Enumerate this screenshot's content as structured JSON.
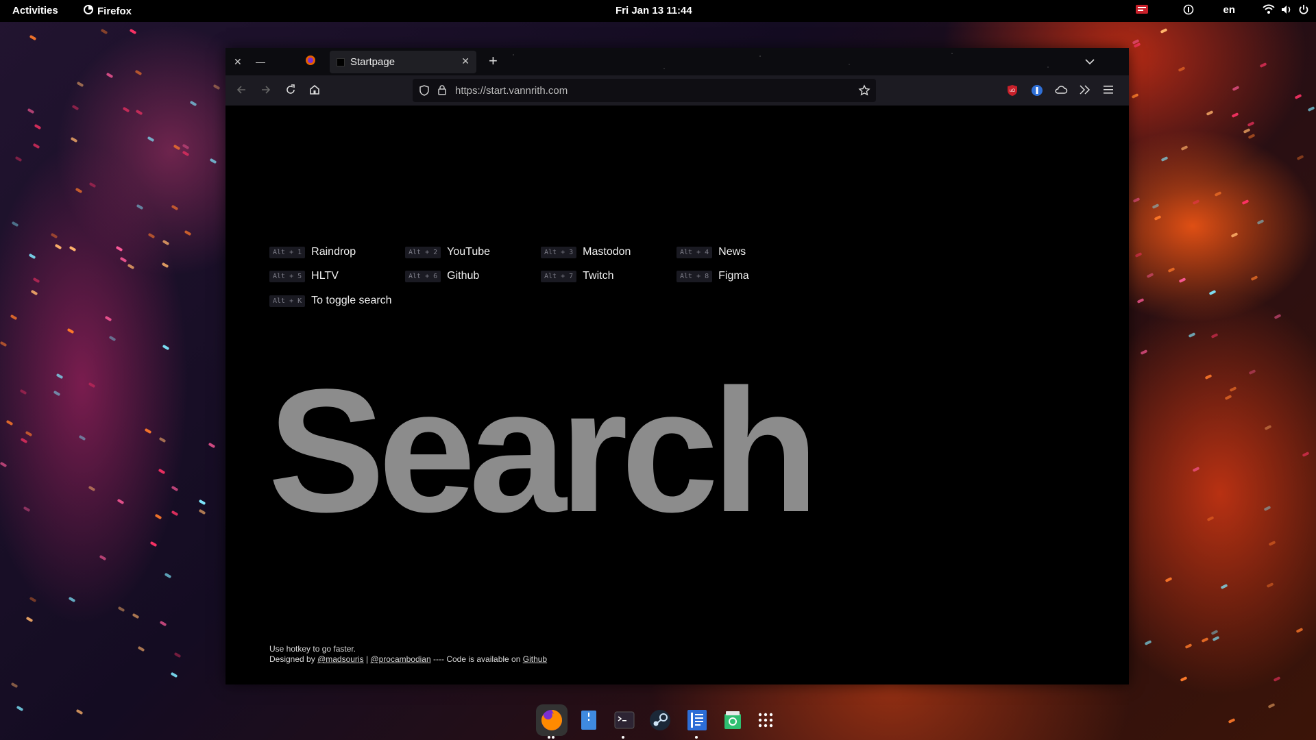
{
  "topbar": {
    "activities": "Activities",
    "app_name": "Firefox",
    "clock": "Fri Jan 13  11:44",
    "language": "en"
  },
  "browser": {
    "tab_title": "Startpage",
    "url": "https://start.vannrith.com"
  },
  "startpage": {
    "links": [
      {
        "hotkey": "Alt + 1",
        "name": "Raindrop"
      },
      {
        "hotkey": "Alt + 2",
        "name": "YouTube"
      },
      {
        "hotkey": "Alt + 3",
        "name": "Mastodon"
      },
      {
        "hotkey": "Alt + 4",
        "name": "News"
      },
      {
        "hotkey": "Alt + 5",
        "name": "HLTV"
      },
      {
        "hotkey": "Alt + 6",
        "name": "Github"
      },
      {
        "hotkey": "Alt + 7",
        "name": "Twitch"
      },
      {
        "hotkey": "Alt + 8",
        "name": "Figma"
      }
    ],
    "toggle_hotkey": "Alt + K",
    "toggle_label": "To toggle search",
    "search_title": "Search",
    "footer": {
      "line1": "Use hotkey to go faster.",
      "designed_by": "Designed by",
      "author1": "@madsouris",
      "separator": "|",
      "author2": "@procambodian",
      "code_text": "---- Code is available on",
      "code_link": "Github"
    }
  },
  "icons": {
    "app_menu": "firefox-icon",
    "tray": [
      "screen-share-icon",
      "one-password-icon",
      "wifi-icon",
      "volume-icon",
      "power-icon"
    ],
    "nav": [
      "back-icon",
      "forward-icon",
      "reload-icon",
      "home-icon"
    ],
    "extensions": [
      "ublock-icon",
      "bitwarden-icon",
      "cloud-icon",
      "overflow-icon",
      "menu-icon"
    ],
    "dock": [
      "firefox-icon",
      "files-icon",
      "terminal-icon",
      "steam-icon",
      "text-editor-icon",
      "software-icon",
      "app-grid-icon"
    ]
  },
  "colors": {
    "accent_red": "#c8202a",
    "title_gray": "#8c8c8c"
  }
}
